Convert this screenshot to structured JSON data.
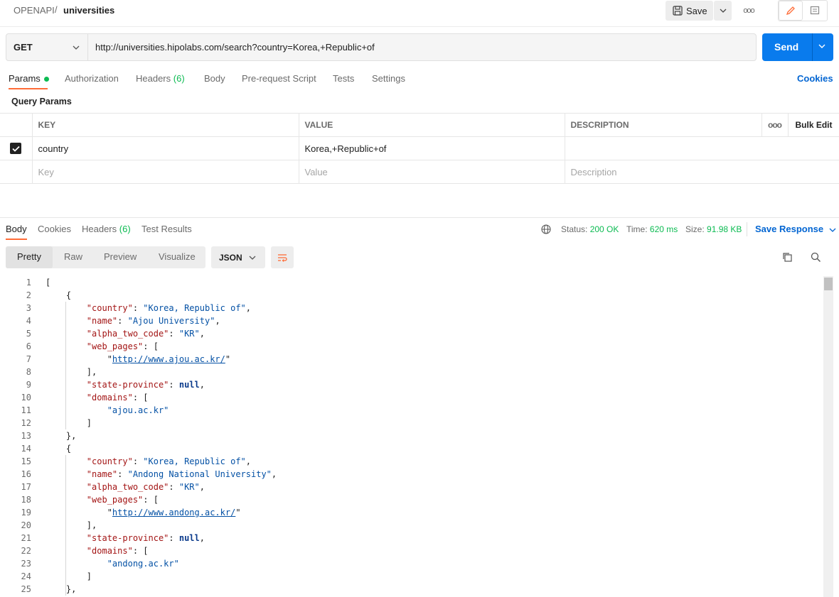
{
  "breadcrumb": {
    "collection": "OPENAPI",
    "separator": "/",
    "request": "universities"
  },
  "toolbar": {
    "save_label": "Save",
    "more": "ooo"
  },
  "request": {
    "method": "GET",
    "url": "http://universities.hipolabs.com/search?country=Korea,+Republic+of",
    "send_label": "Send"
  },
  "req_tabs": [
    {
      "label": "Params"
    },
    {
      "label": "Authorization"
    },
    {
      "label": "Headers",
      "count": "(6)"
    },
    {
      "label": "Body"
    },
    {
      "label": "Pre-request Script"
    },
    {
      "label": "Tests"
    },
    {
      "label": "Settings"
    }
  ],
  "cookies_label": "Cookies",
  "query_params_title": "Query Params",
  "params_table": {
    "headers": [
      "KEY",
      "VALUE",
      "DESCRIPTION"
    ],
    "more": "ooo",
    "bulk_edit": "Bulk Edit",
    "rows": [
      {
        "checked": true,
        "key": "country",
        "value": "Korea,+Republic+of",
        "description": ""
      }
    ],
    "placeholders": {
      "key": "Key",
      "value": "Value",
      "description": "Description"
    }
  },
  "resp_tabs": [
    {
      "label": "Body"
    },
    {
      "label": "Cookies"
    },
    {
      "label": "Headers",
      "count": "(6)"
    },
    {
      "label": "Test Results"
    }
  ],
  "status": {
    "status_label": "Status:",
    "status_value": "200 OK",
    "time_label": "Time:",
    "time_value": "620 ms",
    "size_label": "Size:",
    "size_value": "91.98 KB",
    "save_response": "Save Response"
  },
  "view_modes": [
    "Pretty",
    "Raw",
    "Preview",
    "Visualize"
  ],
  "format": "JSON",
  "colors": {
    "accent": "#ff6c37",
    "send": "#097bed",
    "link": "#0265d2",
    "success": "#0cbb52"
  },
  "code_lines": [
    "[",
    "    {",
    "        \"country\": \"Korea, Republic of\",",
    "        \"name\": \"Ajou University\",",
    "        \"alpha_two_code\": \"KR\",",
    "        \"web_pages\": [",
    "            \"http://www.ajou.ac.kr/\"",
    "        ],",
    "        \"state-province\": null,",
    "        \"domains\": [",
    "            \"ajou.ac.kr\"",
    "        ]",
    "    },",
    "    {",
    "        \"country\": \"Korea, Republic of\",",
    "        \"name\": \"Andong National University\",",
    "        \"alpha_two_code\": \"KR\",",
    "        \"web_pages\": [",
    "            \"http://www.andong.ac.kr/\"",
    "        ],",
    "        \"state-province\": null,",
    "        \"domains\": [",
    "            \"andong.ac.kr\"",
    "        ]",
    "    },"
  ]
}
